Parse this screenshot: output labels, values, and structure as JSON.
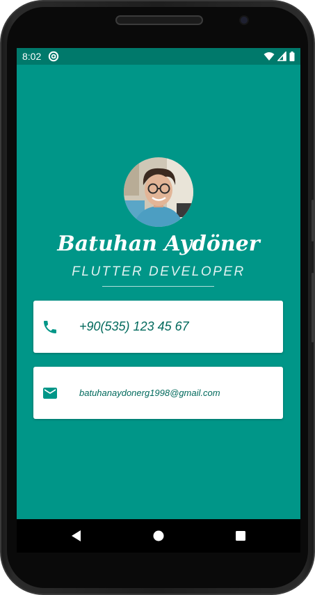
{
  "status_bar": {
    "time": "8:02",
    "app_icon": "at-sign-icon",
    "icons": [
      "wifi-icon",
      "cellular-signal-icon",
      "battery-icon"
    ]
  },
  "profile": {
    "name": "Batuhan Aydöner",
    "title": "FLUTTER DEVELOPER",
    "avatar": "profile-photo"
  },
  "contacts": {
    "phone": {
      "icon": "phone-icon",
      "text": "+90(535) 123 45 67"
    },
    "email": {
      "icon": "email-icon",
      "text": "batuhanaydonerg1998@gmail.com"
    }
  },
  "navigation": {
    "back": "back-icon",
    "home": "home-icon",
    "recents": "recents-icon"
  },
  "colors": {
    "background": "#009688",
    "status_bar": "#00796b",
    "card": "#ffffff",
    "accent_text": "#00695c",
    "icon": "#009688"
  }
}
